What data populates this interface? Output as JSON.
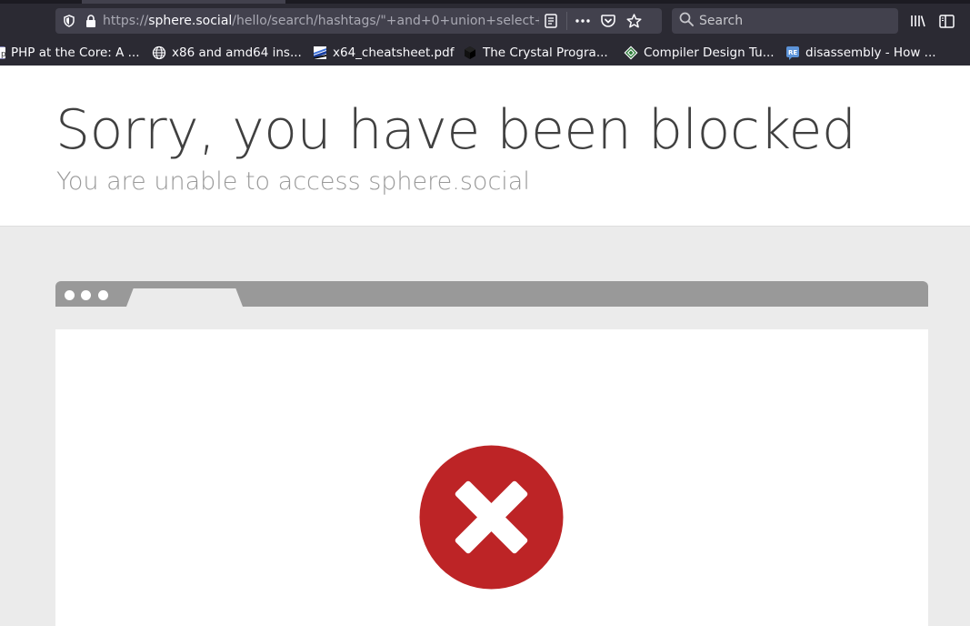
{
  "browser": {
    "url": {
      "scheme": "https://",
      "host": "sphere.social",
      "path": "/hello/search/hashtags/\"+and+0+union+select+"
    },
    "search": {
      "placeholder": "Search"
    },
    "bookmarks": [
      {
        "label": "PHP at the Core: A ...",
        "icon": "php-icon"
      },
      {
        "label": "x86 and amd64 ins...",
        "icon": "globe-icon"
      },
      {
        "label": "x64_cheatsheet.pdf",
        "icon": "pdf-icon"
      },
      {
        "label": "The Crystal Progra...",
        "icon": "crystal-icon"
      },
      {
        "label": "Compiler Design Tu...",
        "icon": "tutorialspoint-icon"
      },
      {
        "label": "disassembly - How ...",
        "icon": "reverse-engineering-icon"
      }
    ]
  },
  "page": {
    "title": "Sorry, you have been blocked",
    "subtitle": "You are unable to access sphere.social"
  },
  "colors": {
    "error_red": "#bd2426",
    "chrome_bg": "#2b2a33",
    "field_bg": "#42414d"
  }
}
